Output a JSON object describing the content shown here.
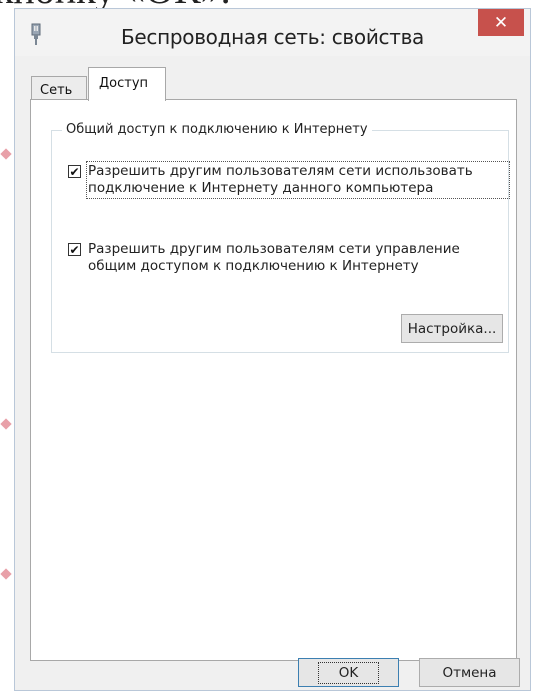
{
  "background": {
    "text": "кнопку «ОК»."
  },
  "dialog": {
    "title": "Беспроводная сеть: свойства",
    "close": "✕",
    "icon": "network-adapter-icon",
    "tabs": [
      {
        "label": "Сеть",
        "active": false
      },
      {
        "label": "Доступ",
        "active": true
      }
    ],
    "group": {
      "title": "Общий доступ к подключению к Интернету",
      "options": [
        {
          "label_line1": "Разрешить другим пользователям сети использовать",
          "label_line2": "подключение к Интернету данного компьютера",
          "checked": true
        },
        {
          "label_line1": "Разрешить другим пользователям сети управление",
          "label_line2": "общим доступом к подключению к Интернету",
          "checked": true
        }
      ],
      "settings_button": "Настройка..."
    },
    "buttons": {
      "ok": "OK",
      "cancel": "Отмена"
    }
  },
  "colors": {
    "close": "#c7514c",
    "accent": "#3c7fb1",
    "marker": "#e8a0a8"
  }
}
